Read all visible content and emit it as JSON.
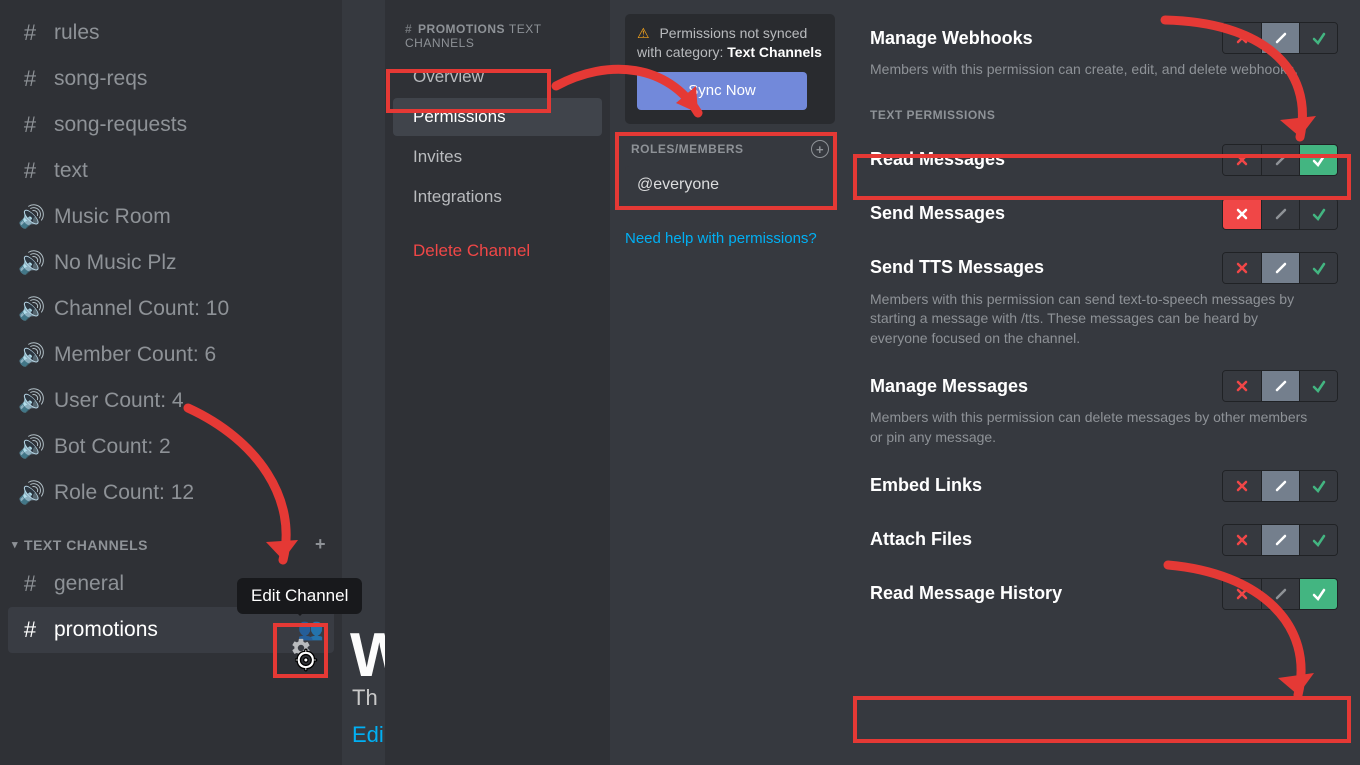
{
  "sidebar": {
    "channels": [
      {
        "type": "text",
        "label": "rules"
      },
      {
        "type": "text",
        "label": "song-reqs"
      },
      {
        "type": "text",
        "label": "song-requests"
      },
      {
        "type": "text",
        "label": "text"
      },
      {
        "type": "voice",
        "label": "Music Room"
      },
      {
        "type": "voice",
        "label": "No Music Plz"
      },
      {
        "type": "voice",
        "label": "Channel Count: 10"
      },
      {
        "type": "voice",
        "label": "Member Count: 6"
      },
      {
        "type": "voice",
        "label": "User Count: 4"
      },
      {
        "type": "voice",
        "label": "Bot Count: 2"
      },
      {
        "type": "voice",
        "label": "Role Count: 12"
      }
    ],
    "category_label": "TEXT CHANNELS",
    "category_items": [
      {
        "label": "general",
        "type": "text",
        "active": false
      },
      {
        "label": "promotions",
        "type": "text",
        "active": true
      }
    ],
    "tooltip": "Edit Channel"
  },
  "background_partial": {
    "big": "W",
    "line1": "Th",
    "line2": "Edi"
  },
  "settings_nav": {
    "crumb_channel": "PROMOTIONS",
    "crumb_sub": "TEXT CHANNELS",
    "items": [
      "Overview",
      "Permissions",
      "Invites",
      "Integrations"
    ],
    "active_index": 1,
    "delete": "Delete Channel"
  },
  "sync_notice": {
    "text_prefix": "Permissions not synced with category: ",
    "category": "Text Channels",
    "button": "Sync Now"
  },
  "roles": {
    "header": "ROLES/MEMBERS",
    "selected": "@everyone"
  },
  "help_link": "Need help with permissions?",
  "text_permissions_label": "TEXT PERMISSIONS",
  "permissions": [
    {
      "key": "manage_webhooks",
      "title": "Manage Webhooks",
      "desc": "Members with this permission can create, edit, and delete webhooks.",
      "state": "slash"
    },
    {
      "key": "read_messages",
      "title": "Read Messages",
      "desc": "",
      "state": "check",
      "section_before": true
    },
    {
      "key": "send_messages",
      "title": "Send Messages",
      "desc": "",
      "state": "deny"
    },
    {
      "key": "send_tts",
      "title": "Send TTS Messages",
      "desc": "Members with this permission can send text-to-speech messages by starting a message with /tts. These messages can be heard by everyone focused on the channel.",
      "state": "slash"
    },
    {
      "key": "manage_messages",
      "title": "Manage Messages",
      "desc": "Members with this permission can delete messages by other members or pin any message.",
      "state": "slash"
    },
    {
      "key": "embed_links",
      "title": "Embed Links",
      "desc": "",
      "state": "slash"
    },
    {
      "key": "attach_files",
      "title": "Attach Files",
      "desc": "",
      "state": "slash"
    },
    {
      "key": "read_history",
      "title": "Read Message History",
      "desc": "",
      "state": "check"
    }
  ],
  "colors": {
    "accent": "#7289da",
    "green": "#43b581",
    "red": "#f04747",
    "highlight": "#e53935"
  }
}
